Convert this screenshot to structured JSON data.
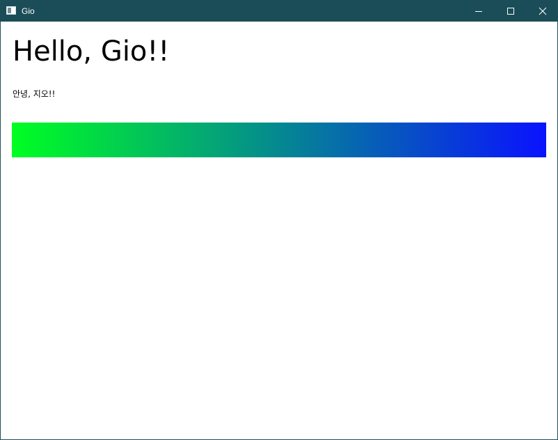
{
  "window": {
    "title": "Gio",
    "titlebar_color": "#1a4d57",
    "icons": {
      "app": "app-window-icon",
      "minimize": "minimize-icon",
      "maximize": "maximize-icon",
      "close": "close-icon"
    }
  },
  "content": {
    "heading": "Hello, Gio!!",
    "greeting": "안녕, 지오!!",
    "gradient": {
      "start_color": "#00ff22",
      "end_color": "#0a12ff"
    }
  }
}
